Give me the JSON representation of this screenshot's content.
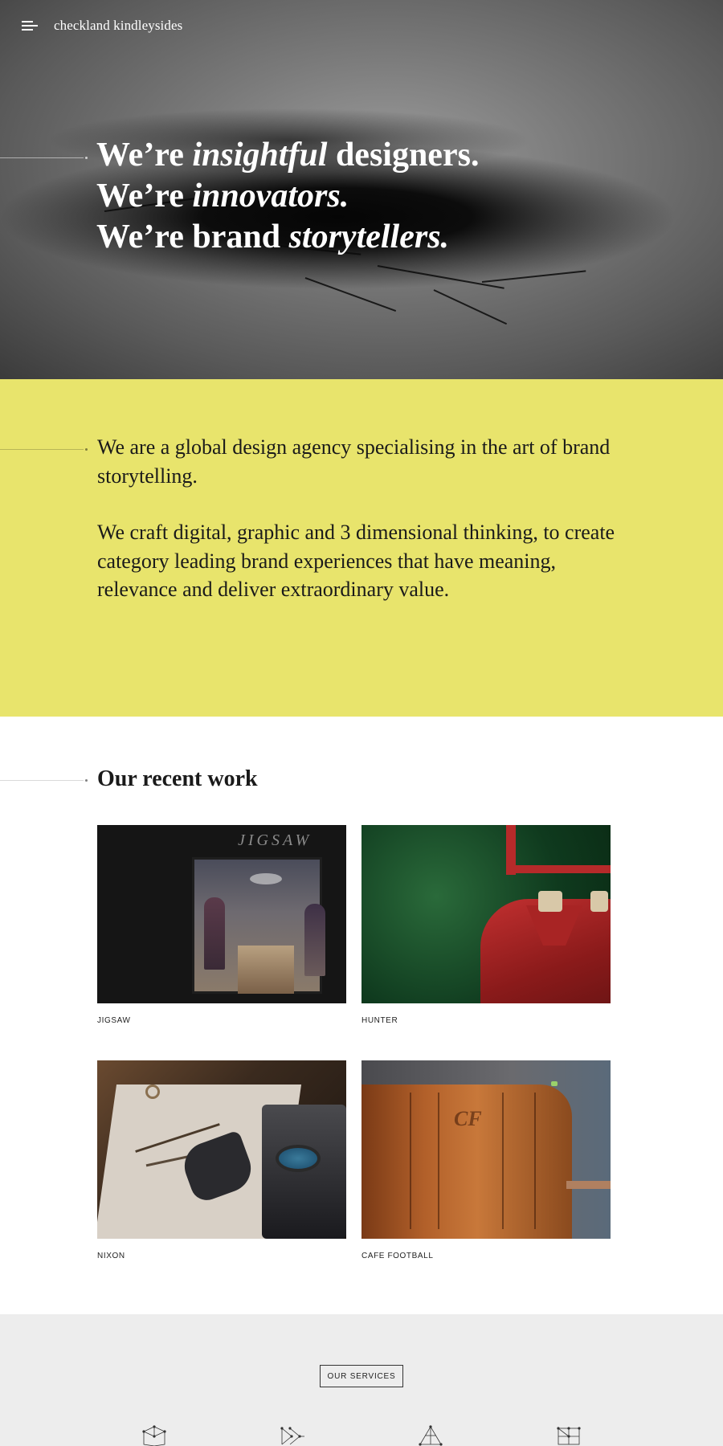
{
  "header": {
    "logo": "checkland kindleysides",
    "menu_icon": "hamburger-menu-icon"
  },
  "hero": {
    "line1_a": "We’re ",
    "line1_em": "insightful",
    "line1_b": " designers.",
    "line2_a": "We’re ",
    "line2_em": "innovators.",
    "line3_a": "We’re brand ",
    "line3_em": "storytellers."
  },
  "intro": {
    "p1": "We are a global design agency specialising in the art of brand storytelling.",
    "p2": "We craft digital, graphic and 3 dimensional thinking, to create category leading brand experiences that have meaning, relevance and deliver extraordinary value."
  },
  "work": {
    "title": "Our recent work",
    "items": [
      {
        "caption": "JIGSAW",
        "sign": "JIGSAW"
      },
      {
        "caption": "HUNTER"
      },
      {
        "caption": "NIXON"
      },
      {
        "caption": "CAFE FOOTBALL",
        "mark": "CF"
      }
    ]
  },
  "services": {
    "button_label": "OUR SERVICES",
    "icons": [
      "cube-network-icon",
      "arrows-network-icon",
      "triangle-network-icon",
      "grid-network-icon"
    ]
  },
  "colors": {
    "intro_bg": "#e8e46c",
    "services_bg": "#ededed"
  }
}
